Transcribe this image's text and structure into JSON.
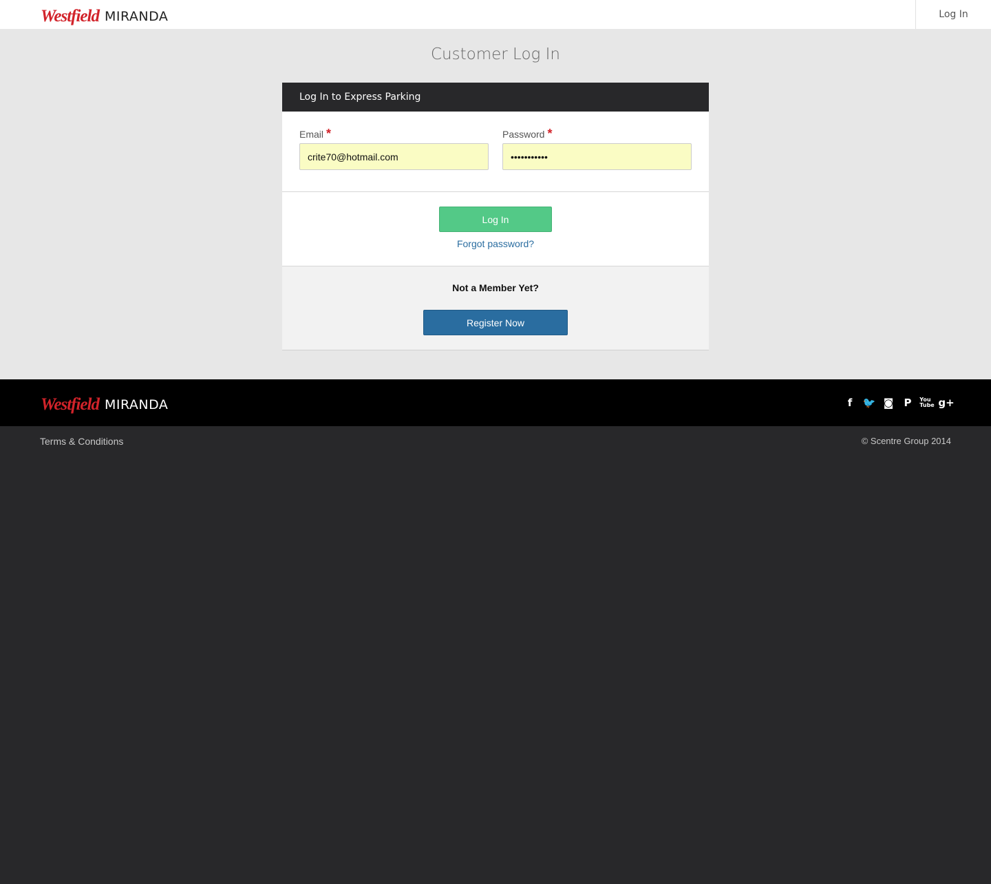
{
  "header": {
    "brand_name": "Westfield",
    "centre_name": "MIRANDA",
    "login_link": "Log In"
  },
  "page": {
    "title": "Customer Log In"
  },
  "login_card": {
    "heading": "Log In to Express Parking",
    "email": {
      "label": "Email",
      "required_mark": "*",
      "value": "crite70@hotmail.com"
    },
    "password": {
      "label": "Password",
      "required_mark": "*",
      "value": "•••••••••••"
    },
    "login_button": "Log In",
    "forgot_link": "Forgot password?",
    "register_prompt": "Not a Member Yet?",
    "register_button": "Register Now"
  },
  "footer": {
    "brand_name": "Westfield",
    "centre_name": "MIRANDA",
    "social": [
      {
        "name": "facebook-icon",
        "glyph": "f"
      },
      {
        "name": "twitter-icon",
        "glyph": "🐦"
      },
      {
        "name": "instagram-icon",
        "glyph": "◙"
      },
      {
        "name": "pinterest-icon",
        "glyph": "P"
      },
      {
        "name": "youtube-icon",
        "glyph": "You Tube"
      },
      {
        "name": "google-plus-icon",
        "glyph": "g+"
      }
    ],
    "terms_link": "Terms & Conditions",
    "copyright": "© Scentre Group 2014"
  },
  "colors": {
    "brand_red": "#d2232a",
    "login_green": "#53c987",
    "register_blue": "#2a6da0",
    "autofill_yellow": "#fafcc4"
  }
}
